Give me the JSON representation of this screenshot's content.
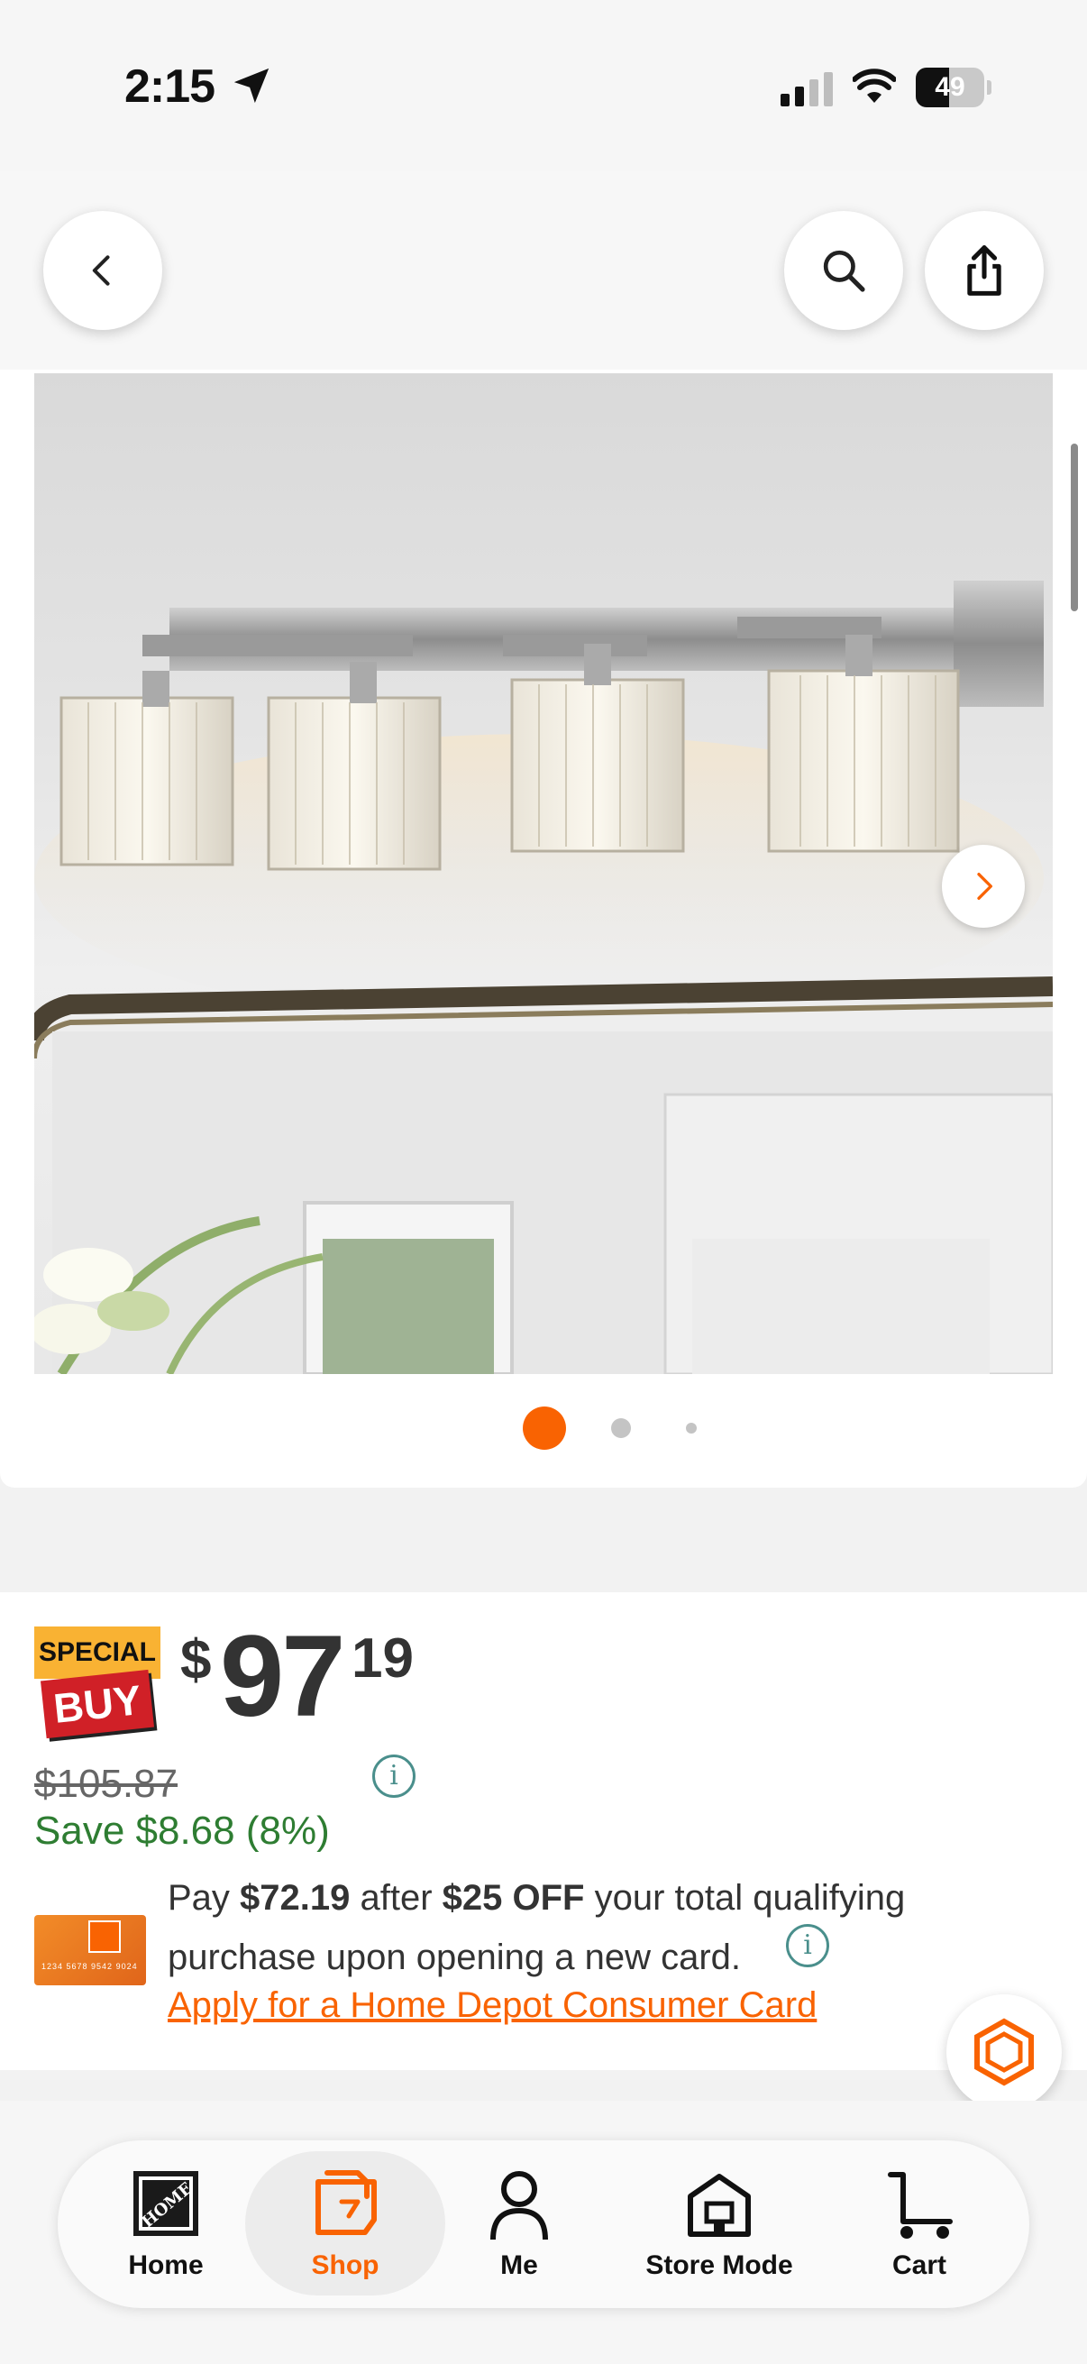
{
  "status_bar": {
    "time": "2:15",
    "battery": "49",
    "battery_level": 0.49,
    "icons": [
      "location-arrow-icon",
      "cellular-signal-icon",
      "wifi-icon",
      "battery-icon"
    ]
  },
  "nav": {
    "back_icon": "chevron-left-icon",
    "search_icon": "search-icon",
    "share_icon": "share-icon"
  },
  "gallery": {
    "image_description_icon": "product-image",
    "next_icon": "chevron-right-icon",
    "page_count": 3,
    "current_page": 1
  },
  "pricing": {
    "badge_top": "SPECIAL",
    "badge_bottom": "BUY",
    "currency": "$",
    "price_whole": "97",
    "price_cents": "19",
    "was_price": "$105.87",
    "save": "Save $8.68 (8%)",
    "info_icon": "info-icon"
  },
  "promo": {
    "pay_prefix": "Pay ",
    "pay_amount": "$72.19",
    "after": " after ",
    "off_amount": "$25 OFF",
    "rest": " your total qualifying purchase upon opening a new card.",
    "apply_link": "Apply for a Home Depot Consumer Card",
    "card_number": "1234 5678 9542 9024"
  },
  "chat": {
    "icon": "chat-hexagon-icon"
  },
  "tabs": [
    {
      "label": "Home",
      "icon": "home-depot-logo-icon",
      "active": false
    },
    {
      "label": "Shop",
      "icon": "shop-tag-icon",
      "active": true
    },
    {
      "label": "Me",
      "icon": "person-icon",
      "active": false
    },
    {
      "label": "Store Mode",
      "icon": "store-icon",
      "active": false
    },
    {
      "label": "Cart",
      "icon": "cart-icon",
      "active": false
    }
  ],
  "colors": {
    "accent": "#f96302",
    "save_green": "#2e7d32",
    "info_teal": "#4a8f8c",
    "badge_yellow": "#f9b233",
    "badge_red": "#d02027"
  }
}
